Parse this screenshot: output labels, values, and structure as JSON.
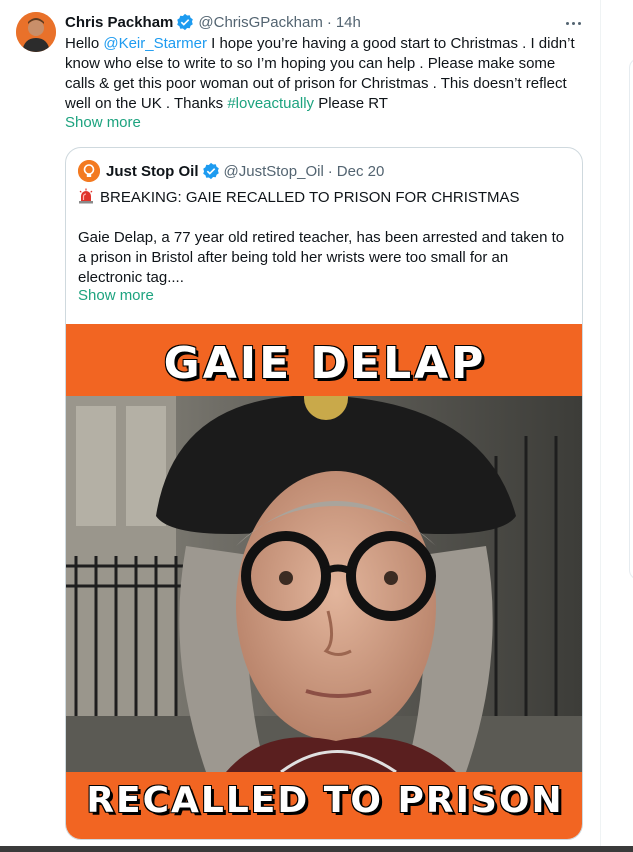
{
  "tweet": {
    "author": {
      "name": "Chris Packham",
      "handle": "@ChrisGPackham",
      "time": "14h",
      "separator": "·",
      "avatar_icon": "person-avatar-icon"
    },
    "text": {
      "part1": "Hello ",
      "mention": "@Keir_Starmer",
      "part2": " I hope you’re having a good start to Christmas . I didn’t know who else to write to so I’m hoping you can help . Please make some calls & get this poor woman out of prison for Christmas . This doesn’t reflect well on the UK . Thanks ",
      "hashtag": "#loveactually",
      "part3": " Please RT"
    },
    "show_more": "Show more",
    "more_icon": "more-horizontal-icon"
  },
  "quote": {
    "author": {
      "name": "Just Stop Oil",
      "handle": "@JustStop_Oil",
      "separator": "·",
      "time": "Dec 20",
      "avatar_icon": "lightbulb-logo-icon"
    },
    "headline": "BREAKING: GAIE RECALLED TO PRISON FOR CHRISTMAS",
    "headline_icon": "siren-icon",
    "body": "Gaie Delap, a 77 year old retired teacher, has been arrested and taken to a prison in Bristol after being told her wrists were too small for an electronic tag....",
    "show_more": "Show more",
    "poster": {
      "title": "GAIE DELAP",
      "bottom": "RECALLED TO PRISON"
    }
  },
  "colors": {
    "accent_green": "#1da37f",
    "mention_blue": "#1d9bf0",
    "brand_orange": "#f26522",
    "verified_blue": "#1d9bf0"
  }
}
